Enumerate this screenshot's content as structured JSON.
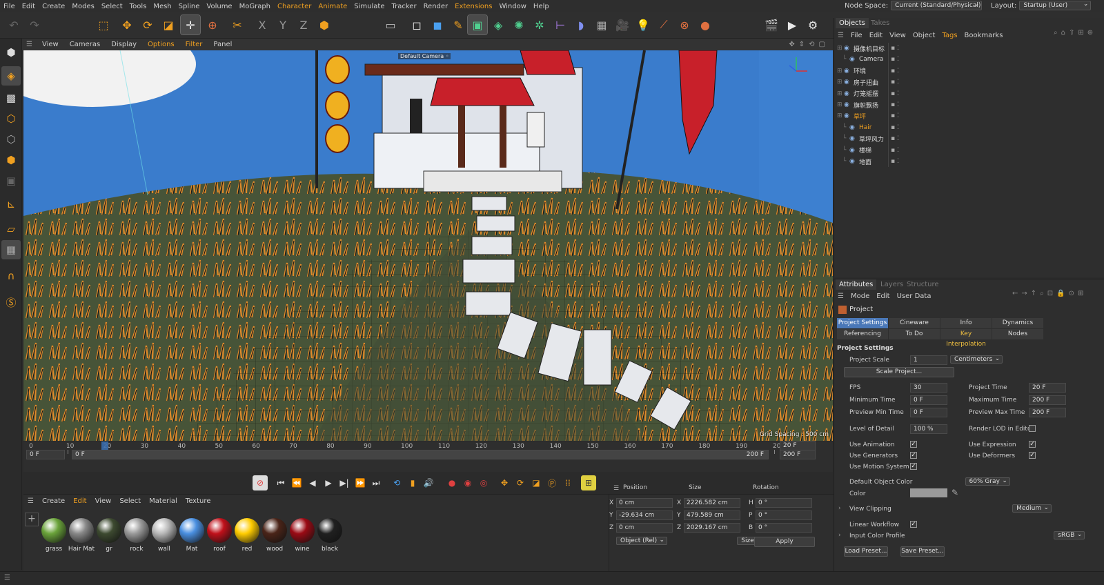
{
  "menubar": {
    "items": [
      "File",
      "Edit",
      "Create",
      "Modes",
      "Select",
      "Tools",
      "Mesh",
      "Spline",
      "Volume",
      "MoGraph",
      "Character",
      "Animate",
      "Simulate",
      "Tracker",
      "Render",
      "Extensions",
      "Window",
      "Help"
    ],
    "highlighted": [
      "Character",
      "Animate",
      "Extensions"
    ],
    "node_space_label": "Node Space:",
    "node_space_value": "Current (Standard/Physical)",
    "layout_label": "Layout:",
    "layout_value": "Startup (User)"
  },
  "viewport": {
    "menu": [
      "View",
      "Cameras",
      "Display",
      "Options",
      "Filter",
      "Panel"
    ],
    "highlighted": "Options",
    "camera_label": "Default Camera ◦",
    "grid_spacing": "Grid Spacing : 500 cm"
  },
  "timeline": {
    "ticks": [
      "0",
      "10",
      "20",
      "30",
      "40",
      "50",
      "60",
      "70",
      "80",
      "90",
      "100",
      "110",
      "120",
      "130",
      "140",
      "150",
      "160",
      "170",
      "180",
      "190",
      "20"
    ],
    "current_frame_field": "20 F",
    "end_frame_field": "200 F",
    "range_start": "0 F",
    "range_inner_start": "0 F",
    "range_inner_end": "200 F",
    "playhead_frame": 20
  },
  "materials": {
    "menu": [
      "Create",
      "Edit",
      "View",
      "Select",
      "Material",
      "Texture"
    ],
    "highlighted": "Edit",
    "items": [
      {
        "name": "grass",
        "color": "#6aa33a"
      },
      {
        "name": "Hair Mat",
        "color": "#888888"
      },
      {
        "name": "gr",
        "color": "#3d4a30"
      },
      {
        "name": "rock",
        "color": "#9a9a9a"
      },
      {
        "name": "wall",
        "color": "#b8b8b8"
      },
      {
        "name": "Mat",
        "color": "#4a8fe0"
      },
      {
        "name": "roof",
        "color": "#c0101a"
      },
      {
        "name": "red",
        "color": "#ffcc00"
      },
      {
        "name": "wood",
        "color": "#4a2418"
      },
      {
        "name": "wine",
        "color": "#9a0a14"
      },
      {
        "name": "black",
        "color": "#202020"
      }
    ]
  },
  "coordinates": {
    "headers": [
      "Position",
      "Size",
      "Rotation"
    ],
    "rows": [
      {
        "axis": "X",
        "pos": "0 cm",
        "size_axis": "X",
        "size": "2226.582 cm",
        "rot_axis": "H",
        "rot": "0 °"
      },
      {
        "axis": "Y",
        "pos": "-29.634 cm",
        "size_axis": "Y",
        "size": "479.589 cm",
        "rot_axis": "P",
        "rot": "0 °"
      },
      {
        "axis": "Z",
        "pos": "0 cm",
        "size_axis": "Z",
        "size": "2029.167 cm",
        "rot_axis": "B",
        "rot": "0 °"
      }
    ],
    "mode": "Object (Rel)",
    "size_mode": "Size",
    "apply": "Apply"
  },
  "objects": {
    "tabs": [
      "Objects",
      "Takes"
    ],
    "menu": [
      "File",
      "Edit",
      "View",
      "Object",
      "Tags",
      "Bookmarks"
    ],
    "highlighted": "Tags",
    "rows": [
      {
        "name": "摄像机目标",
        "indent": 0,
        "color": "#ddd"
      },
      {
        "name": "Camera",
        "indent": 1,
        "color": "#ddd"
      },
      {
        "name": "环境",
        "indent": 0,
        "color": "#ddd"
      },
      {
        "name": "房子扭曲",
        "indent": 0,
        "color": "#ddd"
      },
      {
        "name": "灯笼摇摆",
        "indent": 0,
        "color": "#ddd"
      },
      {
        "name": "旗帜飘扬",
        "indent": 0,
        "color": "#ddd"
      },
      {
        "name": "草坪",
        "indent": 0,
        "color": "#f0a020"
      },
      {
        "name": "Hair",
        "indent": 1,
        "color": "#f0a020"
      },
      {
        "name": "草坪风力",
        "indent": 1,
        "color": "#ddd"
      },
      {
        "name": "楼梯",
        "indent": 1,
        "color": "#ddd"
      },
      {
        "name": "地面",
        "indent": 1,
        "color": "#ddd"
      }
    ]
  },
  "attributes": {
    "tabs": [
      "Attributes",
      "Layers",
      "Structure"
    ],
    "menu": [
      "Mode",
      "Edit",
      "User Data"
    ],
    "object_name": "Project",
    "subtabs_row1": [
      "Project Settings",
      "Cineware",
      "Info",
      "Dynamics"
    ],
    "subtabs_row2": [
      "Referencing",
      "To Do",
      "Key Interpolation",
      "Nodes"
    ],
    "section": "Project Settings",
    "project_scale_label": "Project Scale",
    "project_scale_value": "1",
    "project_scale_unit": "Centimeters",
    "scale_project_btn": "Scale Project...",
    "fps_label": "FPS",
    "fps": "30",
    "project_time_label": "Project Time",
    "project_time": "20 F",
    "min_time_label": "Minimum Time",
    "min_time": "0 F",
    "max_time_label": "Maximum Time",
    "max_time": "200 F",
    "pmin_label": "Preview Min Time",
    "pmin": "0 F",
    "pmax_label": "Preview Max Time",
    "pmax": "200 F",
    "lod_label": "Level of Detail",
    "lod": "100 %",
    "render_lod_label": "Render LOD in Editor",
    "use_animation": "Use Animation",
    "use_expression": "Use Expression",
    "use_generators": "Use Generators",
    "use_deformers": "Use Deformers",
    "use_motion": "Use Motion System",
    "default_color_label": "Default Object Color",
    "default_color": "60% Gray",
    "color_label": "Color",
    "view_clipping_label": "View Clipping",
    "view_clipping": "Medium",
    "linear_workflow": "Linear Workflow",
    "input_profile_label": "Input Color Profile",
    "input_profile": "sRGB",
    "load_preset": "Load Preset...",
    "save_preset": "Save Preset..."
  }
}
